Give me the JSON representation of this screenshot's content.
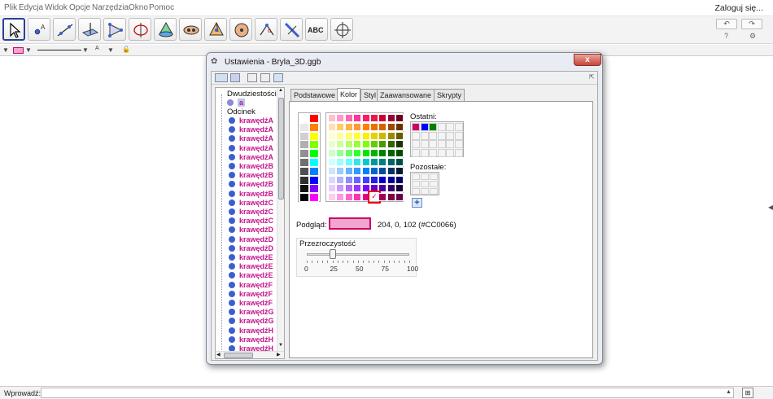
{
  "menu": [
    "Plik",
    "Edycja",
    "Widok",
    "Opcje",
    "Narzędzia",
    "Okno",
    "Pomoc"
  ],
  "login": "Zaloguj się...",
  "toolbar": {
    "abc_label": "ABC",
    "tools": [
      "move-tool",
      "point-tool",
      "line-tool",
      "perpendicular-tool",
      "polygon-tool",
      "circle-tool",
      "cone-tool",
      "intersect-tool",
      "pyramid-tool",
      "sphere-tool",
      "angle-tool",
      "reflect-tool",
      "text-tool",
      "rotate-view-tool"
    ]
  },
  "dialog": {
    "title": "Ustawienia - Bryla_3D.ggb",
    "close_label": "x",
    "tree": {
      "group1": "Dwudziestościan",
      "group1_item": "a",
      "group2": "Odcinek",
      "items": [
        "krawędźA",
        "krawędźA",
        "krawędźA",
        "krawędźA",
        "krawędźA",
        "krawędźB",
        "krawędźB",
        "krawędźB",
        "krawędźB",
        "krawędźC",
        "krawędźC",
        "krawędźC",
        "krawędźD",
        "krawędźD",
        "krawędźD",
        "krawędźE",
        "krawędźE",
        "krawędźE",
        "krawędźF",
        "krawędźF",
        "krawędźF",
        "krawędźG",
        "krawędźG",
        "krawędźH",
        "krawędźH",
        "krawędźH"
      ]
    },
    "tabs": [
      "Podstawowe",
      "Kolor",
      "Styl",
      "Zaawansowane",
      "Skrypty"
    ],
    "active_tab": "Kolor",
    "recent_label": "Ostatni:",
    "recent_colors": [
      "#CC0066",
      "#0000FF",
      "#008000"
    ],
    "other_label": "Pozostałe:",
    "add_label": "+",
    "preview_label": "Podgląd:",
    "preview_value": "204, 0, 102 (#CC0066)",
    "preview_color": "#F2A6CF",
    "selected_color": "#CC0066",
    "transparency_label": "Przezroczystość",
    "transparency_value": 25,
    "ticks": [
      "0",
      "25",
      "50",
      "75",
      "100"
    ],
    "gray_left": [
      "#FFFFFF",
      "#E8E8E8",
      "#D0D0D0",
      "#B0B0B0",
      "#909090",
      "#707070",
      "#505050",
      "#303030",
      "#101010",
      "#000000"
    ],
    "gray_right": [
      "#FF0000",
      "#FF8000",
      "#FFFF00",
      "#80FF00",
      "#00FF00",
      "#00FFFF",
      "#0080FF",
      "#0000FF",
      "#8000FF",
      "#FF00FF"
    ],
    "palette": [
      [
        "#FFC0CB",
        "#FF99CC",
        "#FF66B2",
        "#FF3399",
        "#FF1A66",
        "#E6194B",
        "#CC0033",
        "#990033",
        "#660022"
      ],
      [
        "#FFE0B2",
        "#FFCC66",
        "#FFB347",
        "#FF9933",
        "#FF8000",
        "#E67300",
        "#CC6600",
        "#994C00",
        "#663300"
      ],
      [
        "#FFFFCC",
        "#FFFF99",
        "#FFFF66",
        "#FFFF33",
        "#FFEE00",
        "#E6D200",
        "#CCB800",
        "#998A00",
        "#665C00"
      ],
      [
        "#E6FFCC",
        "#CCFF99",
        "#B3FF66",
        "#99FF33",
        "#80FF00",
        "#66CC00",
        "#4D9900",
        "#336600",
        "#1A3300"
      ],
      [
        "#CCFFCC",
        "#99FF99",
        "#66FF66",
        "#33FF33",
        "#00E600",
        "#00B300",
        "#008000",
        "#006600",
        "#004D00"
      ],
      [
        "#CCFFFF",
        "#99FFFF",
        "#66FFFF",
        "#33E6E6",
        "#00CCCC",
        "#009999",
        "#008080",
        "#006666",
        "#004D4D"
      ],
      [
        "#CCE6FF",
        "#99CCFF",
        "#66B2FF",
        "#3399FF",
        "#0080FF",
        "#0066CC",
        "#004C99",
        "#003366",
        "#001A33"
      ],
      [
        "#D9D9FF",
        "#B3B3FF",
        "#8C8CFF",
        "#6666FF",
        "#4040FF",
        "#2020E6",
        "#0000CC",
        "#000099",
        "#000066"
      ],
      [
        "#E6CCFF",
        "#CC99FF",
        "#B266FF",
        "#9933FF",
        "#8000FF",
        "#6600CC",
        "#4C0099",
        "#330066",
        "#1A0033"
      ],
      [
        "#FFCCF2",
        "#FF99E6",
        "#FF66CC",
        "#FF33B3",
        "#E6008C",
        "#CC0066",
        "#A3005C",
        "#800040",
        "#66004D"
      ]
    ]
  },
  "input": {
    "label": "Wprowadź:"
  },
  "colors": {
    "accent": "#CC0066",
    "tree_item": "#C4148A",
    "dot": "#3B5FD0"
  }
}
